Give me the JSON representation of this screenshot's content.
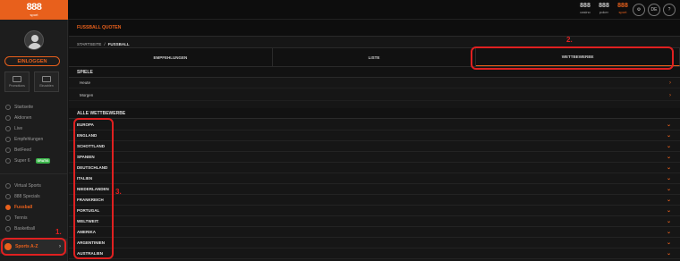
{
  "header": {
    "logo_text": "888",
    "logo_sub": "sport",
    "brands": [
      {
        "num": "888",
        "label": "casino",
        "active": false
      },
      {
        "num": "888",
        "label": "poker",
        "active": false
      },
      {
        "num": "888",
        "label": "sport",
        "active": true
      }
    ],
    "lang": "DE",
    "help": "?"
  },
  "sidebar": {
    "login_label": "EINLOGGEN",
    "promos": [
      {
        "label": "Promotions"
      },
      {
        "label": "Einzahlen"
      }
    ],
    "nav_group1": [
      {
        "label": "Startseite"
      },
      {
        "label": "Aktionen"
      },
      {
        "label": "Live"
      },
      {
        "label": "Empfehlungen"
      },
      {
        "label": "BetFeed"
      },
      {
        "label": "Super 6",
        "badge": "GRATIS"
      }
    ],
    "nav_group2": [
      {
        "label": "Virtual Sports"
      },
      {
        "label": "888 Specials"
      },
      {
        "label": "Fussball",
        "active": true
      },
      {
        "label": "Tennis"
      },
      {
        "label": "Basketball"
      }
    ],
    "sports_az": "Sports A-Z"
  },
  "main": {
    "title": "FUSSBALL QUOTEN",
    "breadcrumb": {
      "home": "STARTSEITE",
      "sep": "/",
      "current": "FUSSBALL"
    },
    "tabs": [
      {
        "label": "EMPFEHLUNGEN"
      },
      {
        "label": "LISTE"
      },
      {
        "label": "WETTBEWERBE",
        "active": true
      }
    ],
    "spiele_header": "SPIELE",
    "spiele": [
      {
        "label": "Heute"
      },
      {
        "label": "Morgen"
      }
    ],
    "all_header": "ALLE WETTBEWERBE",
    "competitions": [
      "EUROPA",
      "ENGLAND",
      "SCHOTTLAND",
      "SPANIEN",
      "DEUTSCHLAND",
      "ITALIEN",
      "NIEDERLANDEN",
      "FRANKREICH",
      "PORTUGAL",
      "WELTWEIT:",
      "AMERIKA",
      "ARGENTINIEN",
      "AUSTRALIEN"
    ]
  },
  "annotations": [
    "1.",
    "2.",
    "3."
  ],
  "colors": {
    "accent": "#e8601c",
    "annotation": "#e02020",
    "badge": "#3bb54a"
  }
}
